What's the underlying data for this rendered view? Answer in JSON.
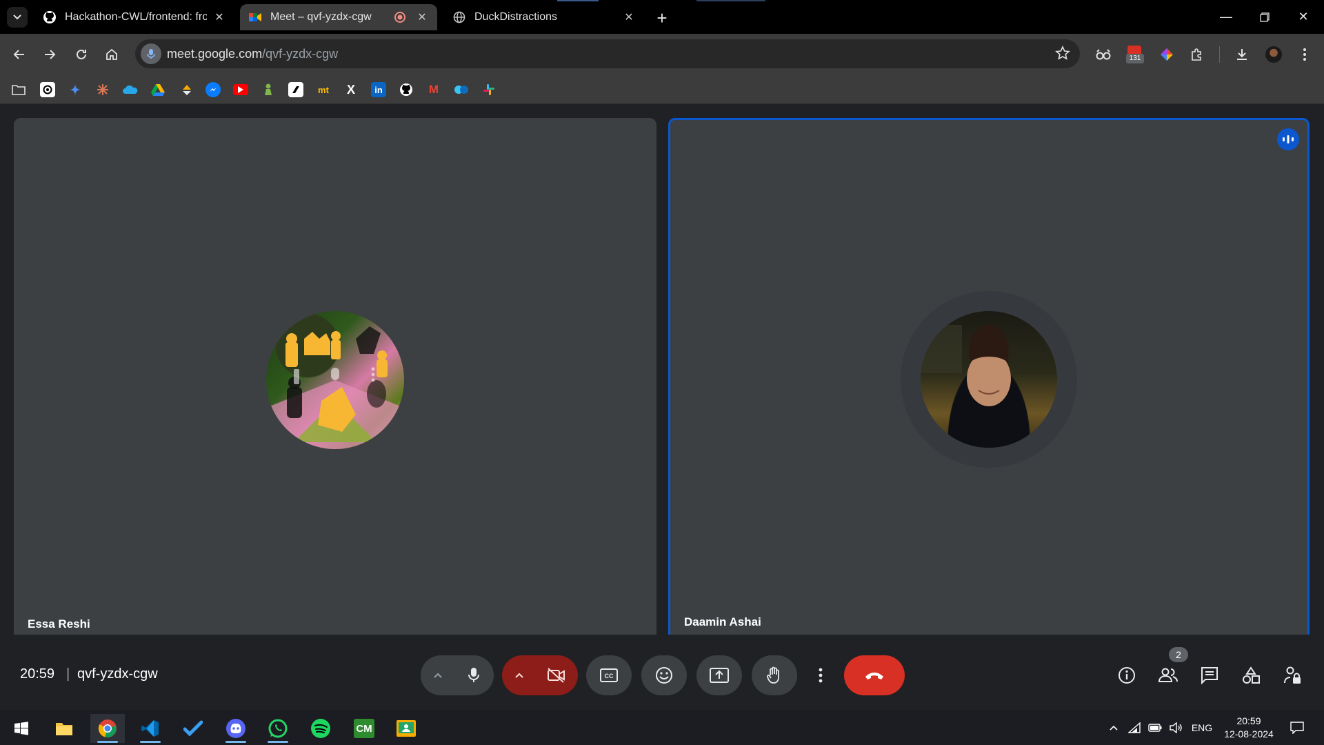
{
  "browser": {
    "tabs": [
      {
        "title": "Hackathon-CWL/frontend: front",
        "icon": "github-icon",
        "active": false
      },
      {
        "title": "Meet – qvf-yzdx-cgw",
        "icon": "google-meet-icon",
        "active": true,
        "recording": true
      },
      {
        "title": "DuckDistractions",
        "icon": "globe-icon",
        "active": false
      }
    ],
    "url_domain": "meet.google.com",
    "url_path": "/qvf-yzdx-cgw",
    "extension_badge": "131",
    "bookmarks": [
      "folder-icon",
      "chatgpt-icon",
      "gemini-icon",
      "claude-icon",
      "onedrive-icon",
      "google-drive-icon",
      "bookmark-app-icon",
      "messenger-icon",
      "youtube-icon",
      "chess-icon",
      "bookmark-app-icon",
      "mt-icon",
      "x-icon",
      "linkedin-icon",
      "github-icon",
      "gmail-icon",
      "copilot-icon",
      "slack-icon"
    ],
    "bookmark_labels": {
      "mt": "mt",
      "x": "X",
      "linkedin": "in",
      "gmail": "M"
    }
  },
  "meet": {
    "participants": [
      {
        "name": "Essa Reshi"
      },
      {
        "name": "Daamin Ashai",
        "speaking": true
      }
    ],
    "time": "20:59",
    "separator": "|",
    "meeting_code": "qvf-yzdx-cgw",
    "people_count": "2",
    "colors": {
      "hangup": "#d93025",
      "camera_off": "#8c1d18",
      "speaking_border": "#0b57d0"
    }
  },
  "taskbar": {
    "apps": [
      "windows-start-icon",
      "file-explorer-icon",
      "chrome-icon",
      "vscode-icon",
      "todo-icon",
      "discord-icon",
      "whatsapp-icon",
      "spotify-icon",
      "cm-icon",
      "classroom-icon"
    ],
    "cm_label": "CM",
    "language": "ENG",
    "time": "20:59",
    "date": "12-08-2024"
  }
}
